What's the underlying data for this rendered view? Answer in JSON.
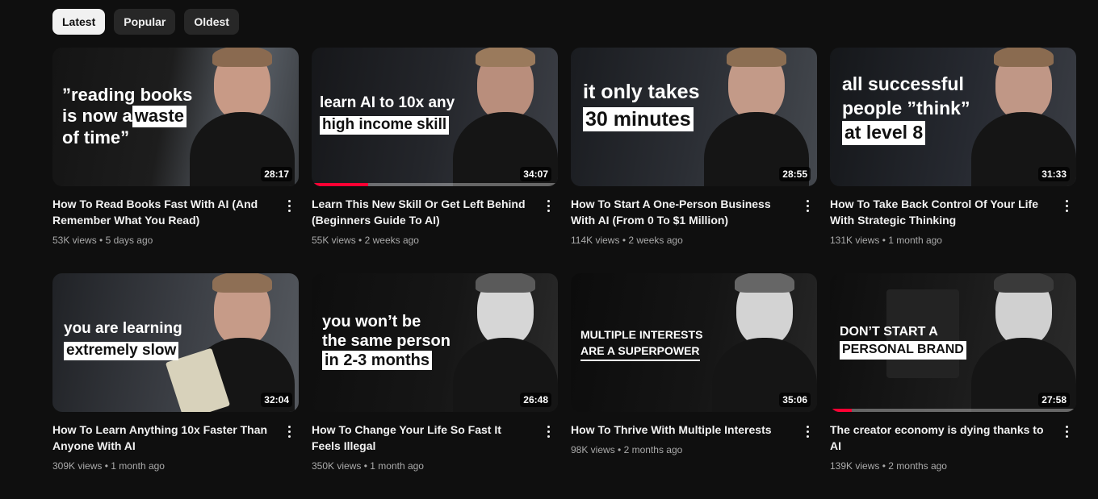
{
  "filters": [
    {
      "label": "Latest",
      "active": true
    },
    {
      "label": "Popular",
      "active": false
    },
    {
      "label": "Oldest",
      "active": false
    }
  ],
  "videos": [
    {
      "title": "How To Read Books Fast With AI (And Remember What You Read)",
      "views": "53K views",
      "age": "5 days ago",
      "duration": "28:17",
      "thumb_lines": [
        "”reading books",
        "is now a ",
        "waste",
        "of time”"
      ],
      "watched_fraction": 0
    },
    {
      "title": "Learn This New Skill Or Get Left Behind (Beginners Guide To AI)",
      "views": "55K views",
      "age": "2 weeks ago",
      "duration": "34:07",
      "thumb_lines": [
        "learn AI to 10x any",
        "high income skill"
      ],
      "watched_fraction": 0.23
    },
    {
      "title": "How To Start A One-Person Business With AI (From 0 To $1 Million)",
      "views": "114K views",
      "age": "2 weeks ago",
      "duration": "28:55",
      "thumb_lines": [
        "it only takes",
        "30 minutes"
      ],
      "watched_fraction": 0
    },
    {
      "title": "How To Take Back Control Of Your Life With Strategic Thinking",
      "views": "131K views",
      "age": "1 month ago",
      "duration": "31:33",
      "thumb_lines": [
        "all successful",
        "people ”think”",
        "at level 8"
      ],
      "watched_fraction": 0
    },
    {
      "title": "How To Learn Anything 10x Faster Than Anyone With AI",
      "views": "309K views",
      "age": "1 month ago",
      "duration": "32:04",
      "thumb_lines": [
        "you are learning",
        "extremely slow"
      ],
      "watched_fraction": 0
    },
    {
      "title": "How To Change Your Life So Fast It Feels Illegal",
      "views": "350K views",
      "age": "1 month ago",
      "duration": "26:48",
      "thumb_lines": [
        "you won’t be",
        "the same person",
        "in 2-3 months"
      ],
      "watched_fraction": 0
    },
    {
      "title": "How To Thrive With Multiple Interests",
      "views": "98K views",
      "age": "2 months ago",
      "duration": "35:06",
      "thumb_lines": [
        "MULTIPLE INTERESTS",
        "ARE A SUPERPOWER"
      ],
      "watched_fraction": 0
    },
    {
      "title": "The creator economy is dying thanks to AI",
      "views": "139K views",
      "age": "2 months ago",
      "duration": "27:58",
      "thumb_lines": [
        "DON’T START A",
        "PERSONAL BRAND"
      ],
      "watched_fraction": 0.09
    }
  ],
  "stats_separator": "•",
  "colors": {
    "background": "#0f0f0f",
    "chip_active": "#f1f1f1",
    "chip_inactive": "#272727",
    "progress": "#ff0033",
    "meta_text": "#aaaaaa"
  },
  "icons": {
    "menu": "more-vert-icon"
  }
}
